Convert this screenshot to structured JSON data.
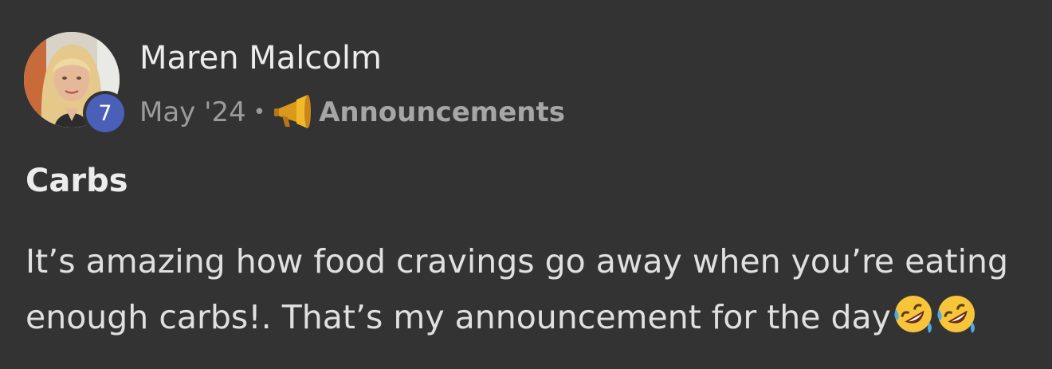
{
  "post": {
    "author": {
      "name": "Maren Malcolm",
      "trust_level_badge": "7"
    },
    "date": "May '24",
    "separator": "•",
    "category": {
      "name": "Announcements",
      "icon": "megaphone-icon"
    },
    "title": "Carbs",
    "body": "It’s amazing how food cravings go away when you’re eating enough carbs!. That’s my announcement for the day",
    "trailing_emojis": [
      "rolling-on-floor-laughing-emoji",
      "rolling-on-floor-laughing-emoji"
    ]
  },
  "colors": {
    "background": "#333333",
    "badge": "#4a5fb8",
    "text_primary": "#ececec",
    "text_muted": "#9b9b9b"
  }
}
